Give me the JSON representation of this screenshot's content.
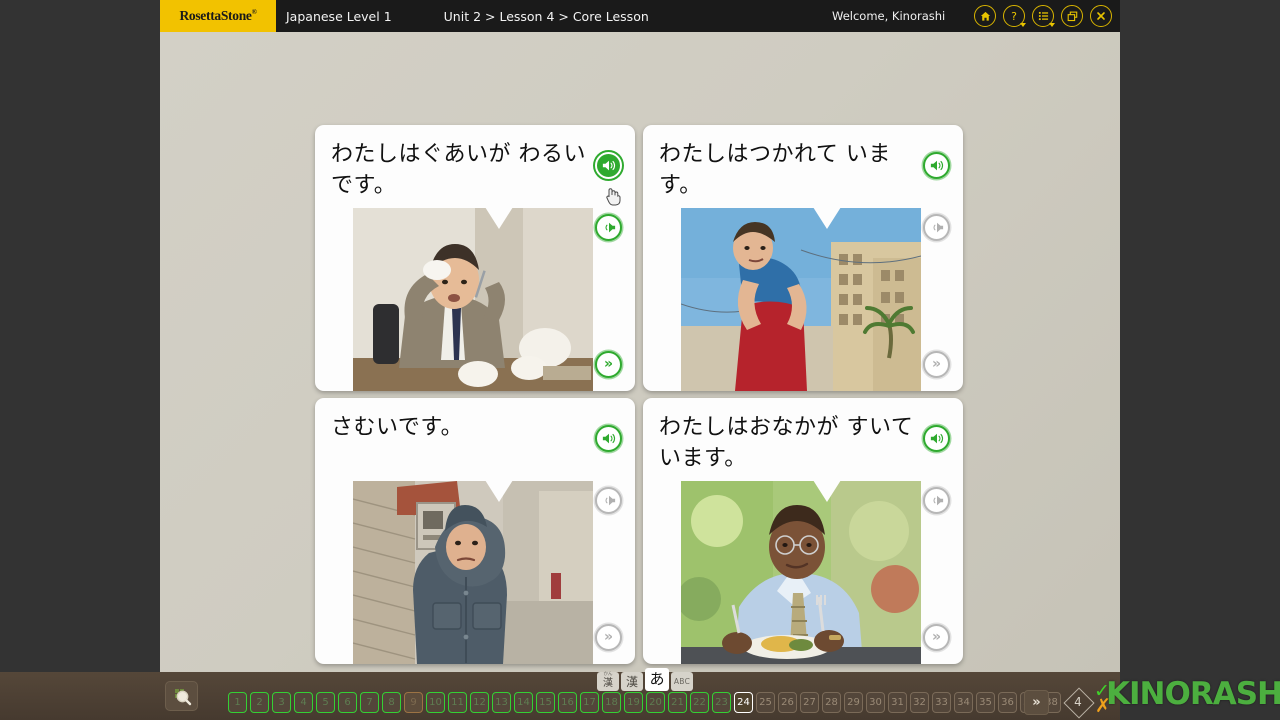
{
  "app": {
    "brand": "RosettaStone",
    "brand_mark": "®",
    "course_title": "Japanese Level 1",
    "breadcrumb": "Unit 2 > Lesson 4 > Core Lesson",
    "welcome": "Welcome, Kinorashi",
    "accent_yellow": "#f2c200",
    "bar_background": "#1a1a1a",
    "stage_background": "#c9c6bb"
  },
  "topbar_icons": [
    {
      "name": "home-icon",
      "label": "Home",
      "has_caret": false
    },
    {
      "name": "help-icon",
      "label": "?",
      "has_caret": true
    },
    {
      "name": "menu-icon",
      "label": "Menu",
      "has_caret": true
    },
    {
      "name": "window-icon",
      "label": "Restore window",
      "has_caret": false
    },
    {
      "name": "close-icon",
      "label": "×",
      "has_caret": false
    }
  ],
  "cards": [
    {
      "id": "card-1",
      "sentence": "わたしはぐあいが わるいです。",
      "speaker_state": "active",
      "replay_state": "green",
      "skip_state": "green",
      "photo": "man-with-fever-wiping-forehead"
    },
    {
      "id": "card-2",
      "sentence": "わたしはつかれて います。",
      "speaker_state": "green",
      "replay_state": "grey",
      "skip_state": "grey",
      "photo": "tired-runner-bent-over"
    },
    {
      "id": "card-3",
      "sentence": "さむいです。",
      "speaker_state": "green",
      "replay_state": "grey",
      "skip_state": "grey",
      "photo": "cold-man-in-hooded-parka"
    },
    {
      "id": "card-4",
      "sentence": "わたしはおなかが すいています。",
      "speaker_state": "green",
      "replay_state": "grey",
      "skip_state": "grey",
      "photo": "hungry-man-eating-at-outdoor-table"
    }
  ],
  "script_toggle": {
    "buttons": [
      {
        "name": "kanji-furigana-button",
        "label": "漢",
        "ruby": "かん",
        "active": false
      },
      {
        "name": "kanji-button",
        "label": "漢",
        "ruby": "",
        "active": false
      },
      {
        "name": "kana-button",
        "label": "あ",
        "ruby": "",
        "active": true
      },
      {
        "name": "romaji-button",
        "label": "ABC",
        "ruby": "",
        "active": false
      }
    ]
  },
  "bottom_bar": {
    "zoom_button_label": "zoom-overview",
    "next_button_label": "»",
    "lesson_number": "4",
    "watermark": "KINORASHI",
    "score_correct_mark": "✓",
    "score_incorrect_mark": "✗",
    "current_item": 24,
    "items": [
      {
        "n": "1",
        "state": "done"
      },
      {
        "n": "2",
        "state": "done"
      },
      {
        "n": "3",
        "state": "done"
      },
      {
        "n": "4",
        "state": "done"
      },
      {
        "n": "5",
        "state": "done"
      },
      {
        "n": "6",
        "state": "done"
      },
      {
        "n": "7",
        "state": "done"
      },
      {
        "n": "8",
        "state": "done"
      },
      {
        "n": "9",
        "state": "missed"
      },
      {
        "n": "10",
        "state": "done"
      },
      {
        "n": "11",
        "state": "done"
      },
      {
        "n": "12",
        "state": "done"
      },
      {
        "n": "13",
        "state": "done"
      },
      {
        "n": "14",
        "state": "done"
      },
      {
        "n": "15",
        "state": "done"
      },
      {
        "n": "16",
        "state": "done"
      },
      {
        "n": "17",
        "state": "done"
      },
      {
        "n": "18",
        "state": "done"
      },
      {
        "n": "19",
        "state": "done"
      },
      {
        "n": "20",
        "state": "done"
      },
      {
        "n": "21",
        "state": "done"
      },
      {
        "n": "22",
        "state": "done"
      },
      {
        "n": "23",
        "state": "done"
      },
      {
        "n": "24",
        "state": "current"
      },
      {
        "n": "25",
        "state": "future"
      },
      {
        "n": "26",
        "state": "future"
      },
      {
        "n": "27",
        "state": "future"
      },
      {
        "n": "28",
        "state": "future"
      },
      {
        "n": "29",
        "state": "future"
      },
      {
        "n": "30",
        "state": "future"
      },
      {
        "n": "31",
        "state": "future"
      },
      {
        "n": "32",
        "state": "future"
      },
      {
        "n": "33",
        "state": "future"
      },
      {
        "n": "34",
        "state": "future"
      },
      {
        "n": "35",
        "state": "future"
      },
      {
        "n": "36",
        "state": "future"
      },
      {
        "n": "37",
        "state": "future"
      },
      {
        "n": "38",
        "state": "future"
      }
    ]
  }
}
